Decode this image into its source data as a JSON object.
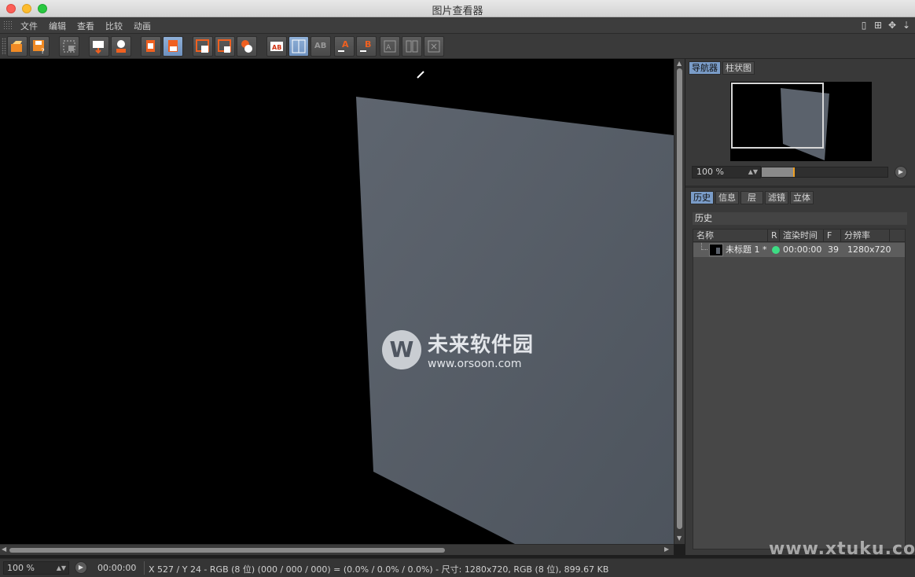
{
  "window": {
    "title": "图片查看器"
  },
  "menu": {
    "items": [
      "文件",
      "编辑",
      "查看",
      "比较",
      "动画"
    ]
  },
  "toolbar": {
    "buttons": [
      {
        "name": "open-file-icon"
      },
      {
        "name": "save-file-icon"
      },
      {
        "name": "grid-icon"
      },
      {
        "name": "export-icon"
      },
      {
        "name": "user-export-icon"
      },
      {
        "name": "copy-icon"
      },
      {
        "name": "paste-icon"
      },
      {
        "name": "view-single-icon"
      },
      {
        "name": "view-compare-icon"
      },
      {
        "name": "view-overlay-icon"
      },
      {
        "name": "ab-compare-icon"
      },
      {
        "name": "ab-split-icon"
      },
      {
        "name": "ab-text-icon"
      },
      {
        "name": "set-a-icon"
      },
      {
        "name": "set-b-icon"
      },
      {
        "name": "swap-icon"
      },
      {
        "name": "split-view-icon"
      },
      {
        "name": "rotate-icon"
      }
    ]
  },
  "viewer": {
    "watermark": {
      "logo": "W",
      "title": "未来软件园",
      "url": "www.orsoon.com"
    }
  },
  "navigator": {
    "tabs": [
      "导航器",
      "柱状图"
    ],
    "active_tab": "导航器",
    "zoom_value": "100 %",
    "zoom_level_fraction": 0.25
  },
  "history_panel": {
    "tabs": [
      "历史",
      "信息",
      "层",
      "滤镜",
      "立体"
    ],
    "active_tab": "历史",
    "section_title": "历史",
    "columns": [
      "名称",
      "R",
      "渲染时间",
      "F",
      "分辨率"
    ],
    "rows": [
      {
        "name": "未标题 1 *",
        "render_time": "00:00:00",
        "frames": "39",
        "resolution": "1280x720",
        "status_color": "#3ddc84"
      }
    ]
  },
  "statusbar": {
    "zoom": "100 %",
    "time": "00:00:00",
    "info": "X 527 / Y 24 - RGB (8 位) (000 / 000 / 000) = (0.0% / 0.0% / 0.0%) - 尺寸: 1280x720, RGB (8 位), 899.67 KB"
  },
  "corner_watermark": "www.xtuku.com"
}
